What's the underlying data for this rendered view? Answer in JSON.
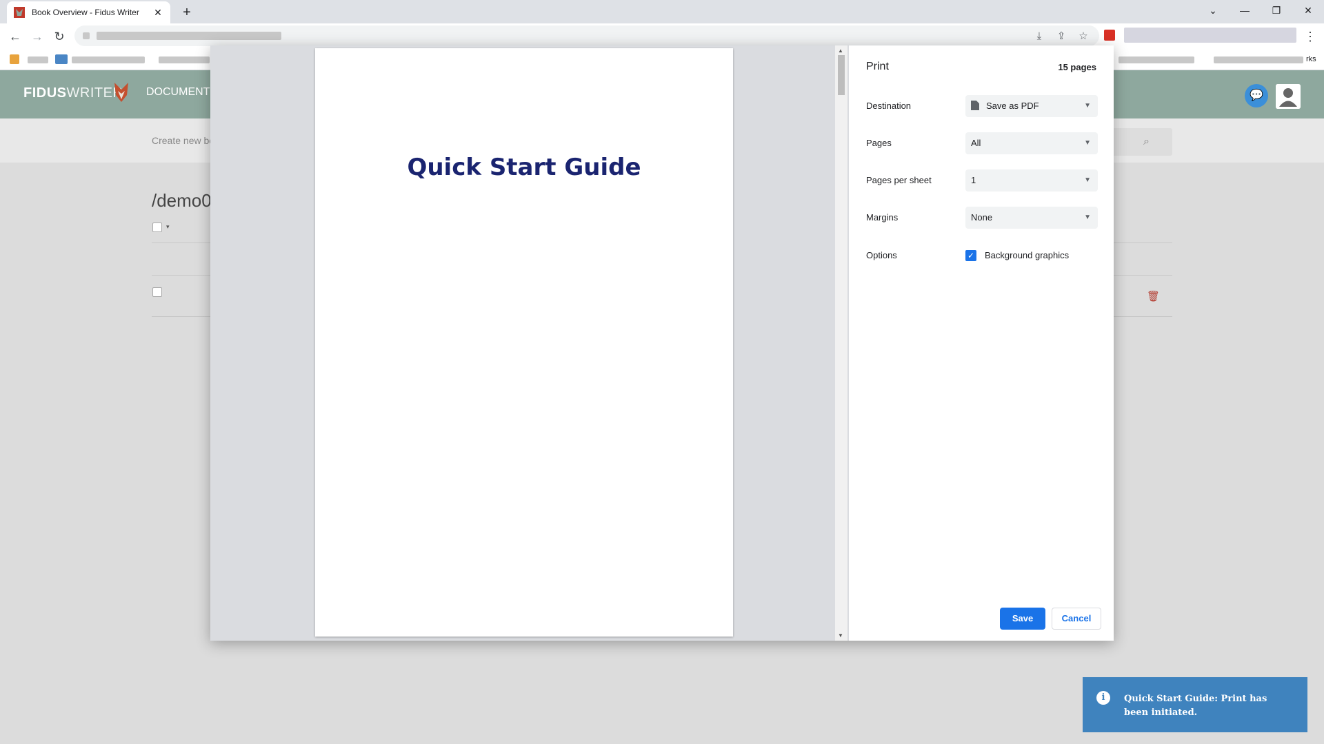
{
  "browser": {
    "tab_title": "Book Overview - Fidus Writer",
    "new_tab": "+",
    "close_tab": "✕",
    "window_controls": [
      "⌄",
      "—",
      "❐",
      "✕"
    ],
    "bookmarks_tail": "rks"
  },
  "app": {
    "logo_bold": "FIDUS",
    "logo_light": "WRITER",
    "nav_documents": "DOCUMENT",
    "create_button": "Create new bo",
    "folder_path": "/demo0"
  },
  "print": {
    "title": "Print",
    "page_count": "15 pages",
    "destination_label": "Destination",
    "destination_value": "Save as PDF",
    "pages_label": "Pages",
    "pages_value": "All",
    "pages_per_sheet_label": "Pages per sheet",
    "pages_per_sheet_value": "1",
    "margins_label": "Margins",
    "margins_value": "None",
    "options_label": "Options",
    "background_graphics_label": "Background graphics",
    "background_graphics_checked": true,
    "save_label": "Save",
    "cancel_label": "Cancel",
    "preview_title": "Quick Start Guide"
  },
  "toast": {
    "message": "Quick Start Guide: Print has been initiated."
  },
  "colors": {
    "header_bg": "#8ea89e",
    "primary_blue": "#1a73e8",
    "toast_bg": "#3f83be",
    "preview_title": "#1a2470"
  }
}
